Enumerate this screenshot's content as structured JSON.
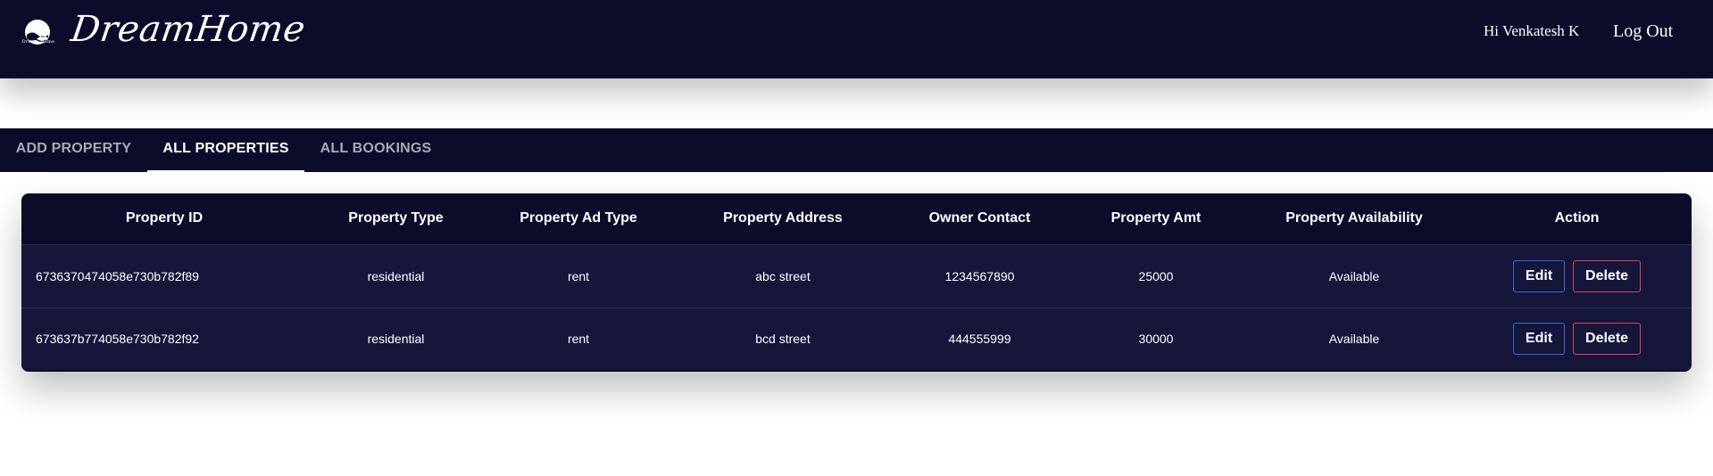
{
  "header": {
    "brand": "DreamHome",
    "logo_caption": "Dream Home",
    "greeting": "Hi Venkatesh K",
    "logout_label": "Log Out"
  },
  "tabs": [
    {
      "label": "ADD PROPERTY",
      "active": false
    },
    {
      "label": "ALL PROPERTIES",
      "active": true
    },
    {
      "label": "ALL BOOKINGS",
      "active": false
    }
  ],
  "table": {
    "columns": [
      "Property ID",
      "Property Type",
      "Property Ad Type",
      "Property Address",
      "Owner Contact",
      "Property Amt",
      "Property Availability",
      "Action"
    ],
    "rows": [
      {
        "id": "6736370474058e730b782f89",
        "type": "residential",
        "ad_type": "rent",
        "address": "abc street",
        "contact": "1234567890",
        "amount": "25000",
        "availability": "Available"
      },
      {
        "id": "673637b774058e730b782f92",
        "type": "residential",
        "ad_type": "rent",
        "address": "bcd street",
        "contact": "444555999",
        "amount": "30000",
        "availability": "Available"
      }
    ],
    "edit_label": "Edit",
    "delete_label": "Delete"
  },
  "colors": {
    "navy": "#0b0c2a",
    "row_bg": "#15163a",
    "edit_border": "#2f6fd8",
    "delete_border": "#d84a62"
  }
}
